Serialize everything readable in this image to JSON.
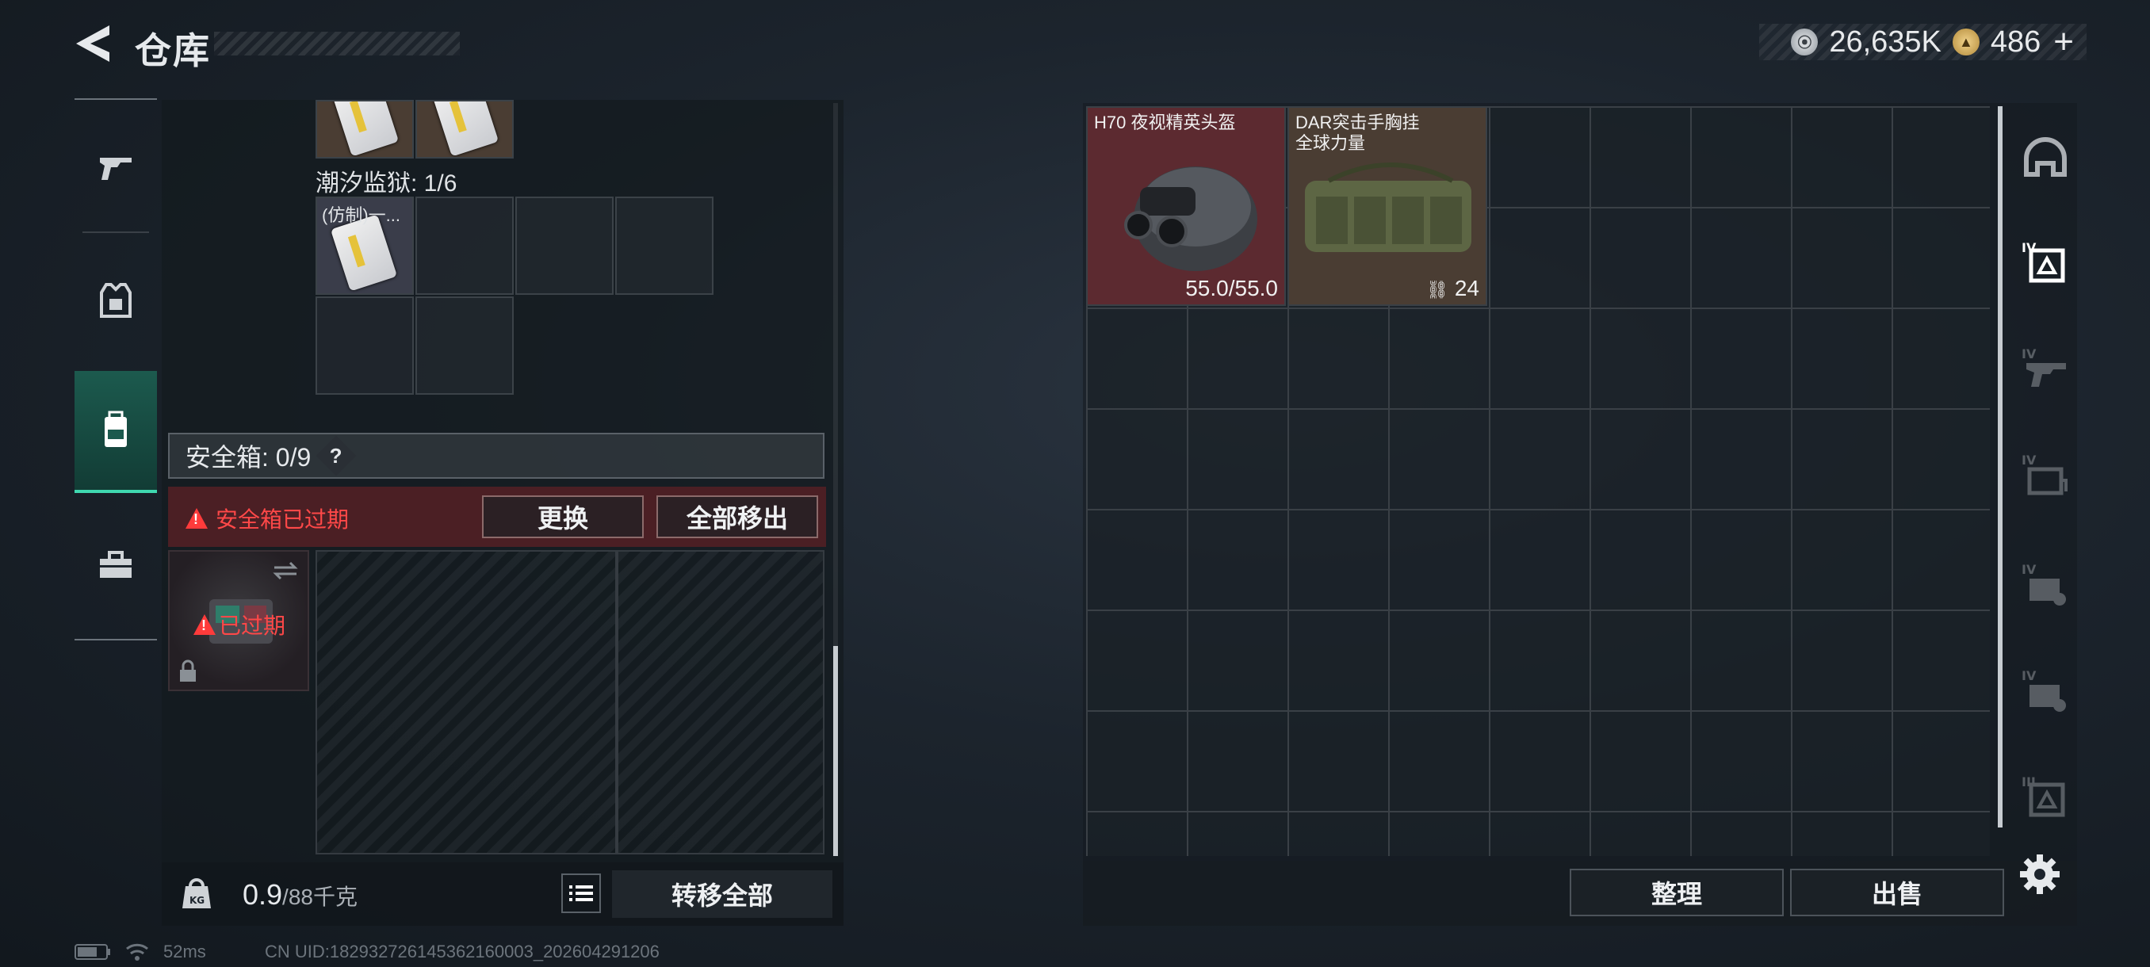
{
  "header": {
    "title": "仓库",
    "currency_silver": "26,635K",
    "currency_gold": "486",
    "plus": "+"
  },
  "left": {
    "section_label": "潮汐监狱: 1/6",
    "cell_item_label": "(仿制)一...",
    "safe_label": "安全箱: 0/9",
    "safe_help": "?",
    "warn_text": "安全箱已过期",
    "replace_btn": "更换",
    "move_all_btn": "全部移出",
    "expired_label": "已过期",
    "weight_value": "0.9",
    "weight_total": "/88千克",
    "transfer_all_btn": "转移全部"
  },
  "right": {
    "items": [
      {
        "name": "H70 夜视精英头盔",
        "value": "55.0/55.0"
      },
      {
        "name": "DAR突击手胸挂",
        "name2": "全球力量",
        "value": "24"
      }
    ],
    "organize_btn": "整理",
    "sell_btn": "出售"
  },
  "status": {
    "ping": "52ms",
    "uid": "CN UID:182932726145362160003_202604291206"
  },
  "colors": {
    "accent": "#3fd8b0",
    "warning": "#ff4848",
    "warn_bg": "#4b1f24",
    "helmet_bg": "#5c2a30",
    "vest_bg": "#4a3d33"
  }
}
